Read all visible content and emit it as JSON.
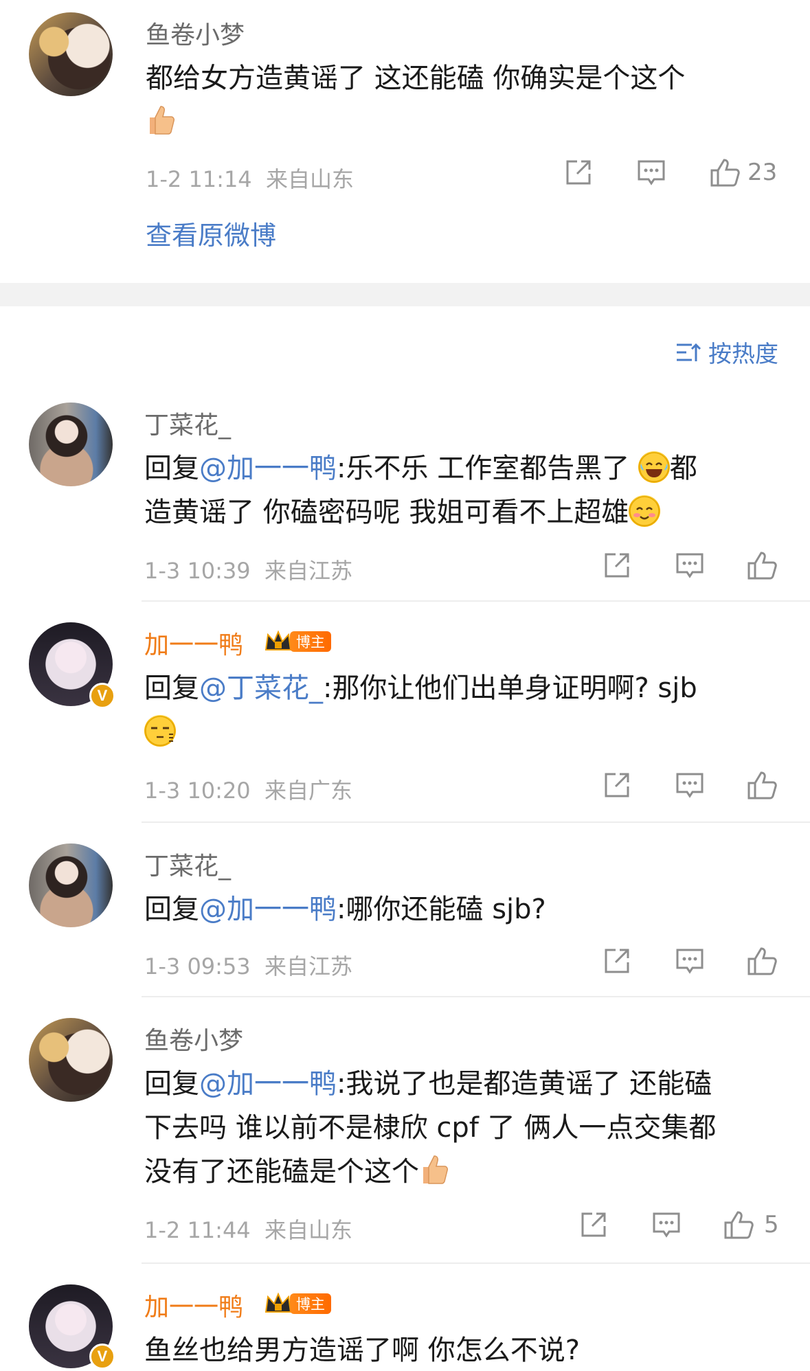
{
  "top_comment": {
    "username": "鱼卷小梦",
    "text": "都给女方造黄谣了 这还能磕 你确实是个这个",
    "emoji": "thumbs-up",
    "time": "1-2 11:14",
    "location": "来自山东",
    "likes": "23",
    "view_original": "查看原微博"
  },
  "sort_label": "按热度",
  "replies": [
    {
      "username": "丁菜花_",
      "reply_prefix": "回复",
      "mention": "@加一一鸭",
      "text_a": ":乐不乐 工作室都告黑了 ",
      "text_b": "都",
      "text_c": "造黄谣了 你磕密码呢 我姐可看不上超雄",
      "time": "1-3 10:39",
      "location": "来自江苏"
    },
    {
      "username": "加一一鸭",
      "badge": "博主",
      "reply_prefix": "回复",
      "mention": "@丁菜花_",
      "text_a": ":那你让他们出单身证明啊? sjb",
      "time": "1-3 10:20",
      "location": "来自广东"
    },
    {
      "username": "丁菜花_",
      "reply_prefix": "回复",
      "mention": "@加一一鸭",
      "text_a": ":哪你还能磕 sjb?",
      "time": "1-3 09:53",
      "location": "来自江苏"
    },
    {
      "username": "鱼卷小梦",
      "reply_prefix": "回复",
      "mention": "@加一一鸭",
      "text_a": ":我说了也是都造黄谣了 还能磕",
      "text_b": "下去吗 谁以前不是棣欣 cpf 了 俩人一点交集都",
      "text_c": "没有了还能磕是个这个",
      "time": "1-2 11:44",
      "location": "来自山东",
      "likes": "5"
    },
    {
      "username": "加一一鸭",
      "badge": "博主",
      "text_a": "鱼丝也给男方造谣了啊 你怎么不说?"
    }
  ],
  "colors": {
    "link": "#4a7cc7",
    "blogger": "#f07c18",
    "meta": "#a6a6a6"
  }
}
